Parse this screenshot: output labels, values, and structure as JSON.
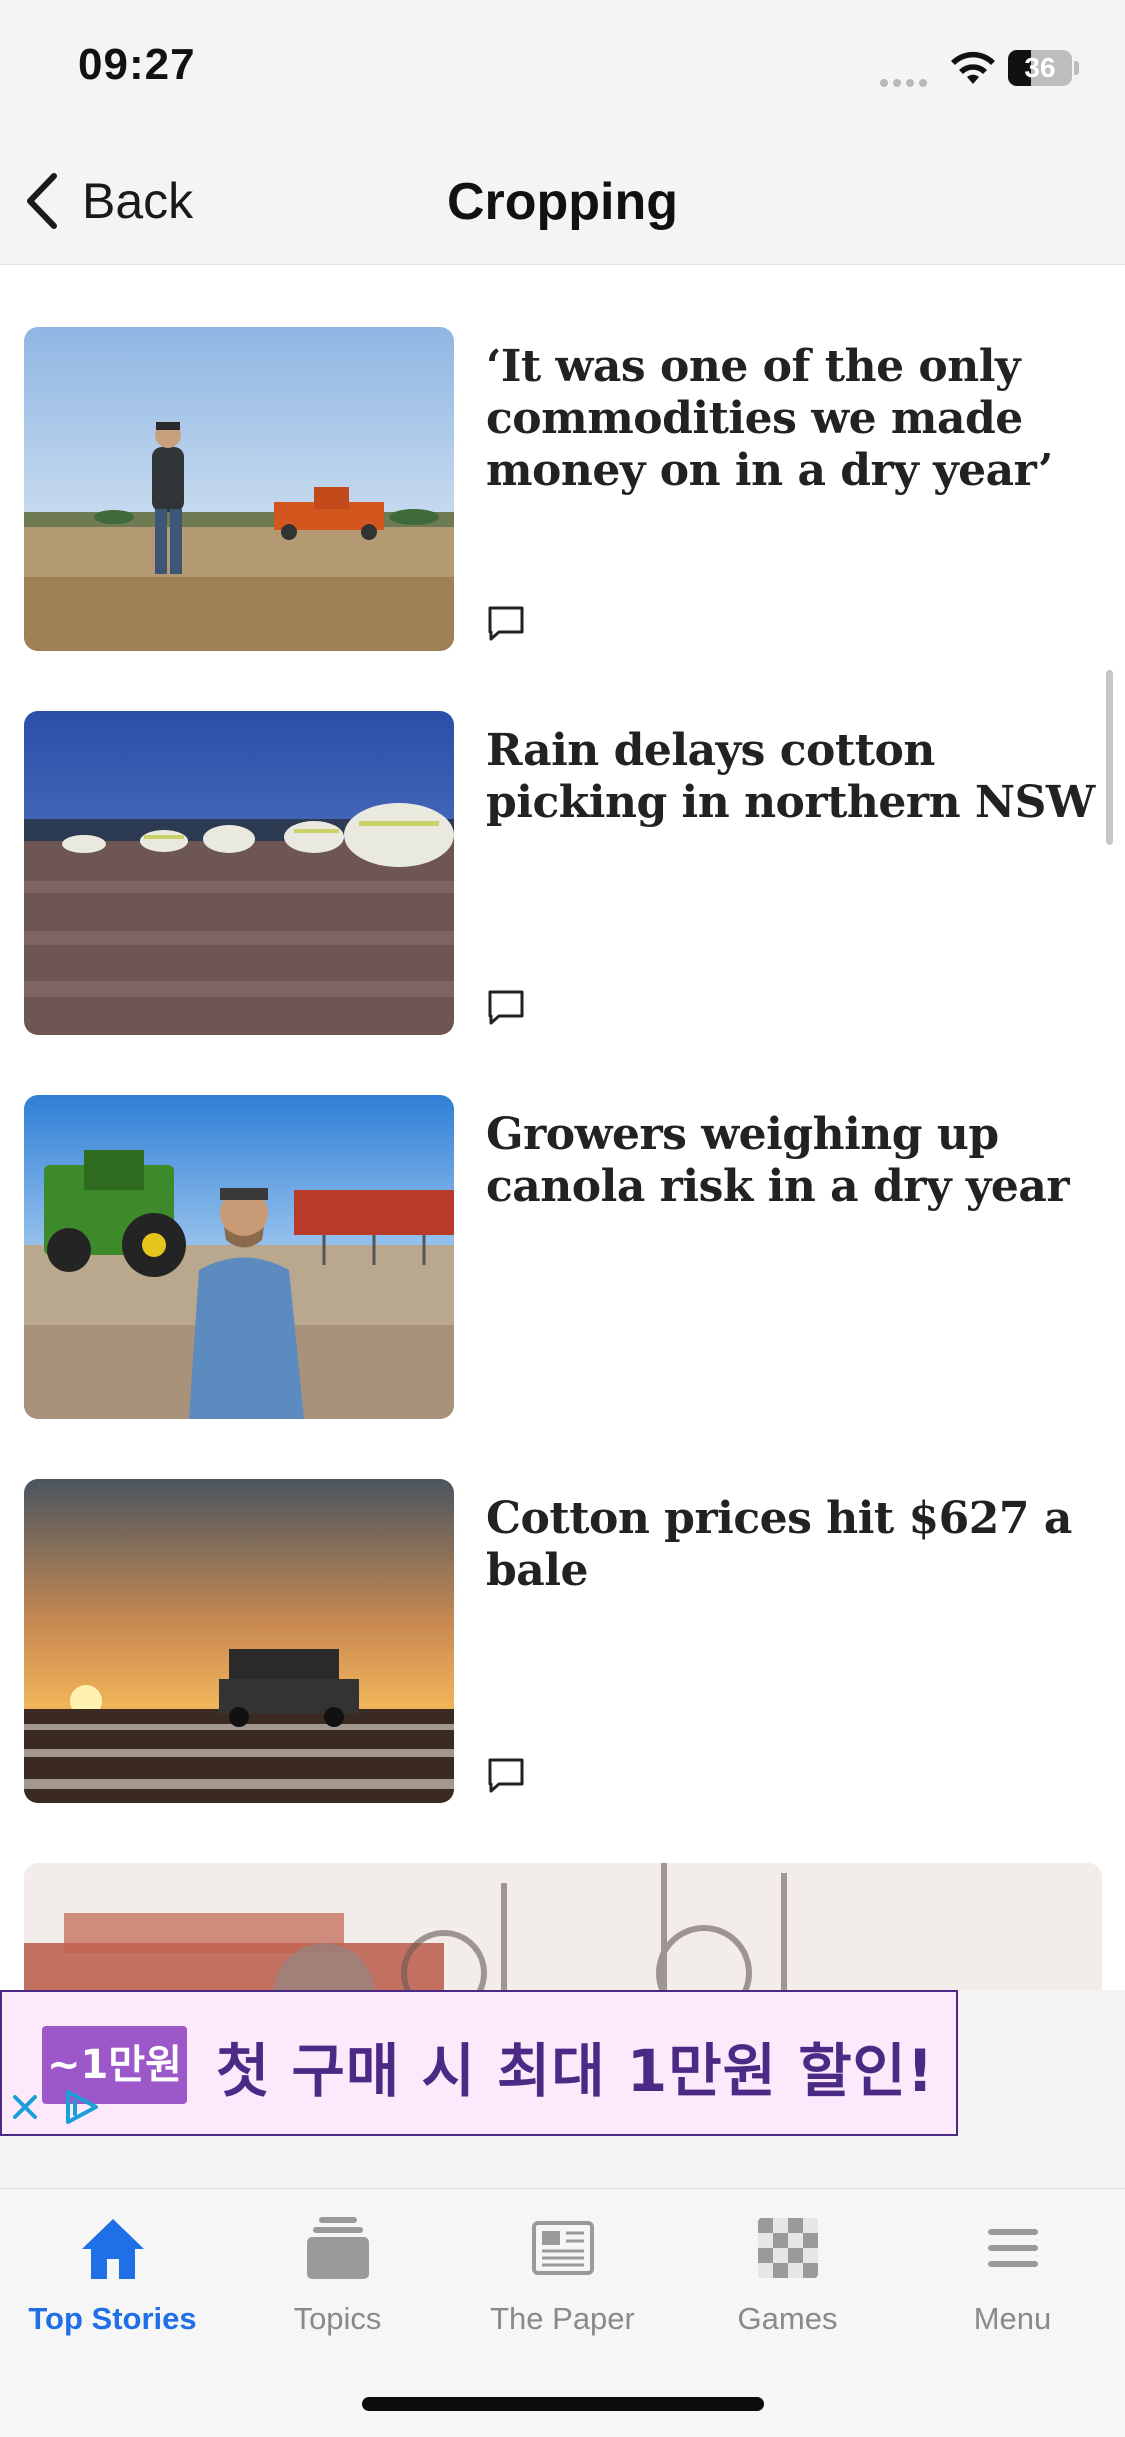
{
  "status_bar": {
    "time": "09:27",
    "battery_level": "36",
    "battery_percent": 36
  },
  "header": {
    "back_label": "Back",
    "title": "Cropping"
  },
  "articles": [
    {
      "headline": "‘It was one of the only commodities we made money on in a dry year’",
      "image": "farmer-in-paddock-with-seeder",
      "has_comments": true
    },
    {
      "headline": "Rain delays cotton picking in northern NSW",
      "image": "cotton-field-with-round-bales",
      "has_comments": true
    },
    {
      "headline": "Growers weighing up canola risk in a dry year",
      "image": "farmer-with-tractor-and-seeder",
      "has_comments": false
    },
    {
      "headline": "Cotton prices hit $627 a bale",
      "image": "cotton-picker-at-sunset",
      "has_comments": true
    }
  ],
  "ad": {
    "badge": "~1만원",
    "text": "첫 구매 시 최대 1만원 할인!",
    "accent_color": "#4b2a86",
    "background_color": "#fce9fb"
  },
  "tabs": [
    {
      "label": "Top Stories",
      "icon": "home-icon",
      "active": true
    },
    {
      "label": "Topics",
      "icon": "topics-icon",
      "active": false
    },
    {
      "label": "The Paper",
      "icon": "newspaper-icon",
      "active": false
    },
    {
      "label": "Games",
      "icon": "games-icon",
      "active": false
    },
    {
      "label": "Menu",
      "icon": "menu-icon",
      "active": false
    }
  ],
  "colors": {
    "accent": "#1f6fe6",
    "tab_inactive": "#8a8a8a"
  }
}
